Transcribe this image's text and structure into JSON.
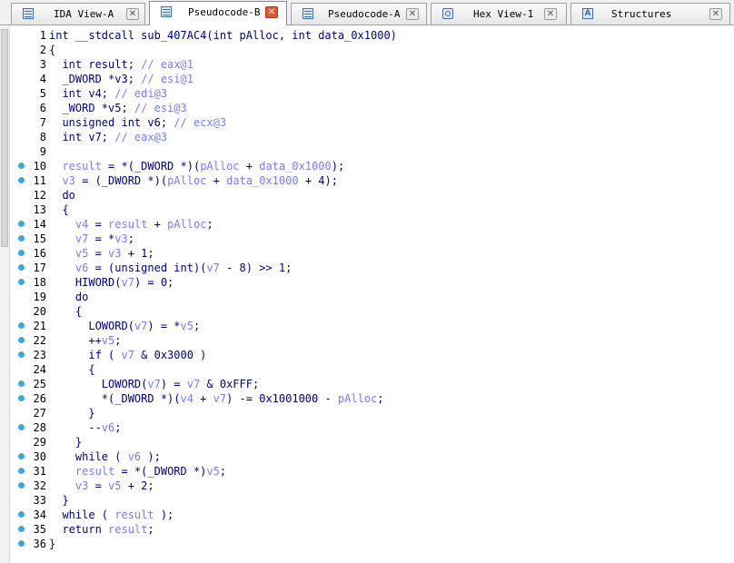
{
  "colors": {
    "keyword": "#000080",
    "variable": "#7a7aff",
    "comment": "#7a7aff",
    "breakpoint": "#3ea6e8",
    "active_tab_close": "#e8542c"
  },
  "tabs": [
    {
      "label": "IDA View-A",
      "icon": "document-icon",
      "active": false
    },
    {
      "label": "Pseudocode-B",
      "icon": "document-icon",
      "active": true
    },
    {
      "label": "Pseudocode-A",
      "icon": "document-icon",
      "active": false
    },
    {
      "label": "Hex View-1",
      "icon": "hex-icon",
      "active": false
    },
    {
      "label": "Structures",
      "icon": "structures-icon",
      "active": false,
      "icon_text": "A"
    }
  ],
  "close_glyph": "✕",
  "code_lines": [
    {
      "n": "1",
      "bp": false,
      "tokens": [
        [
          "int __stdcall sub_407AC4(int pAlloc, int data_0x1000)",
          "k"
        ]
      ]
    },
    {
      "n": "2",
      "bp": false,
      "tokens": [
        [
          "{",
          "p"
        ]
      ]
    },
    {
      "n": "3",
      "bp": false,
      "tokens": [
        [
          "  int result; ",
          "k"
        ],
        [
          "// eax@1",
          "c"
        ]
      ]
    },
    {
      "n": "4",
      "bp": false,
      "tokens": [
        [
          "  _DWORD *v3; ",
          "k"
        ],
        [
          "// esi@1",
          "c"
        ]
      ]
    },
    {
      "n": "5",
      "bp": false,
      "tokens": [
        [
          "  int v4; ",
          "k"
        ],
        [
          "// edi@3",
          "c"
        ]
      ]
    },
    {
      "n": "6",
      "bp": false,
      "tokens": [
        [
          "  _WORD *v5; ",
          "k"
        ],
        [
          "// esi@3",
          "c"
        ]
      ]
    },
    {
      "n": "7",
      "bp": false,
      "tokens": [
        [
          "  unsigned int v6; ",
          "k"
        ],
        [
          "// ecx@3",
          "c"
        ]
      ]
    },
    {
      "n": "8",
      "bp": false,
      "tokens": [
        [
          "  int v7; ",
          "k"
        ],
        [
          "// eax@3",
          "c"
        ]
      ]
    },
    {
      "n": "9",
      "bp": false,
      "tokens": [
        [
          "",
          "p"
        ]
      ]
    },
    {
      "n": "10",
      "bp": true,
      "tokens": [
        [
          "  ",
          "p"
        ],
        [
          "result",
          "v"
        ],
        [
          " = *(_DWORD *)(",
          "p"
        ],
        [
          "pAlloc",
          "v"
        ],
        [
          " + ",
          "p"
        ],
        [
          "data_0x1000",
          "v"
        ],
        [
          ");",
          "p"
        ]
      ]
    },
    {
      "n": "11",
      "bp": true,
      "tokens": [
        [
          "  ",
          "p"
        ],
        [
          "v3",
          "v"
        ],
        [
          " = (_DWORD *)(",
          "p"
        ],
        [
          "pAlloc",
          "v"
        ],
        [
          " + ",
          "p"
        ],
        [
          "data_0x1000",
          "v"
        ],
        [
          " + 4);",
          "p"
        ]
      ]
    },
    {
      "n": "12",
      "bp": false,
      "tokens": [
        [
          "  do",
          "k"
        ]
      ]
    },
    {
      "n": "13",
      "bp": false,
      "tokens": [
        [
          "  {",
          "p"
        ]
      ]
    },
    {
      "n": "14",
      "bp": true,
      "tokens": [
        [
          "    ",
          "p"
        ],
        [
          "v4",
          "v"
        ],
        [
          " = ",
          "p"
        ],
        [
          "result",
          "v"
        ],
        [
          " + ",
          "p"
        ],
        [
          "pAlloc",
          "v"
        ],
        [
          ";",
          "p"
        ]
      ]
    },
    {
      "n": "15",
      "bp": true,
      "tokens": [
        [
          "    ",
          "p"
        ],
        [
          "v7",
          "v"
        ],
        [
          " = *",
          "p"
        ],
        [
          "v3",
          "v"
        ],
        [
          ";",
          "p"
        ]
      ]
    },
    {
      "n": "16",
      "bp": true,
      "tokens": [
        [
          "    ",
          "p"
        ],
        [
          "v5",
          "v"
        ],
        [
          " = ",
          "p"
        ],
        [
          "v3",
          "v"
        ],
        [
          " + 1;",
          "p"
        ]
      ]
    },
    {
      "n": "17",
      "bp": true,
      "tokens": [
        [
          "    ",
          "p"
        ],
        [
          "v6",
          "v"
        ],
        [
          " = (unsigned int)(",
          "p"
        ],
        [
          "v7",
          "v"
        ],
        [
          " - 8) >> 1;",
          "p"
        ]
      ]
    },
    {
      "n": "18",
      "bp": true,
      "tokens": [
        [
          "    HIWORD(",
          "p"
        ],
        [
          "v7",
          "v"
        ],
        [
          ") = 0;",
          "p"
        ]
      ]
    },
    {
      "n": "19",
      "bp": false,
      "tokens": [
        [
          "    do",
          "k"
        ]
      ]
    },
    {
      "n": "20",
      "bp": false,
      "tokens": [
        [
          "    {",
          "p"
        ]
      ]
    },
    {
      "n": "21",
      "bp": true,
      "tokens": [
        [
          "      LOWORD(",
          "p"
        ],
        [
          "v7",
          "v"
        ],
        [
          ") = *",
          "p"
        ],
        [
          "v5",
          "v"
        ],
        [
          ";",
          "p"
        ]
      ]
    },
    {
      "n": "22",
      "bp": true,
      "tokens": [
        [
          "      ++",
          "p"
        ],
        [
          "v5",
          "v"
        ],
        [
          ";",
          "p"
        ]
      ]
    },
    {
      "n": "23",
      "bp": true,
      "tokens": [
        [
          "      if ( ",
          "p"
        ],
        [
          "v7",
          "v"
        ],
        [
          " & 0x3000 )",
          "p"
        ]
      ]
    },
    {
      "n": "24",
      "bp": false,
      "tokens": [
        [
          "      {",
          "p"
        ]
      ]
    },
    {
      "n": "25",
      "bp": true,
      "tokens": [
        [
          "        LOWORD(",
          "p"
        ],
        [
          "v7",
          "v"
        ],
        [
          ") = ",
          "p"
        ],
        [
          "v7",
          "v"
        ],
        [
          " & 0xFFF;",
          "p"
        ]
      ]
    },
    {
      "n": "26",
      "bp": true,
      "tokens": [
        [
          "        *(_DWORD *)(",
          "p"
        ],
        [
          "v4",
          "v"
        ],
        [
          " + ",
          "p"
        ],
        [
          "v7",
          "v"
        ],
        [
          ") -= 0x1001000 - ",
          "p"
        ],
        [
          "pAlloc",
          "v"
        ],
        [
          ";",
          "p"
        ]
      ]
    },
    {
      "n": "27",
      "bp": false,
      "tokens": [
        [
          "      }",
          "p"
        ]
      ]
    },
    {
      "n": "28",
      "bp": true,
      "tokens": [
        [
          "      --",
          "p"
        ],
        [
          "v6",
          "v"
        ],
        [
          ";",
          "p"
        ]
      ]
    },
    {
      "n": "29",
      "bp": false,
      "tokens": [
        [
          "    }",
          "p"
        ]
      ]
    },
    {
      "n": "30",
      "bp": true,
      "tokens": [
        [
          "    while ( ",
          "p"
        ],
        [
          "v6",
          "v"
        ],
        [
          " );",
          "p"
        ]
      ]
    },
    {
      "n": "31",
      "bp": true,
      "tokens": [
        [
          "    ",
          "p"
        ],
        [
          "result",
          "v"
        ],
        [
          " = *(_DWORD *)",
          "p"
        ],
        [
          "v5",
          "v"
        ],
        [
          ";",
          "p"
        ]
      ]
    },
    {
      "n": "32",
      "bp": true,
      "tokens": [
        [
          "    ",
          "p"
        ],
        [
          "v3",
          "v"
        ],
        [
          " = ",
          "p"
        ],
        [
          "v5",
          "v"
        ],
        [
          " + 2;",
          "p"
        ]
      ]
    },
    {
      "n": "33",
      "bp": false,
      "tokens": [
        [
          "  }",
          "p"
        ]
      ]
    },
    {
      "n": "34",
      "bp": true,
      "tokens": [
        [
          "  while ( ",
          "p"
        ],
        [
          "result",
          "v"
        ],
        [
          " );",
          "p"
        ]
      ]
    },
    {
      "n": "35",
      "bp": true,
      "tokens": [
        [
          "  return ",
          "p"
        ],
        [
          "result",
          "v"
        ],
        [
          ";",
          "p"
        ]
      ]
    },
    {
      "n": "36",
      "bp": true,
      "tokens": [
        [
          "}",
          "p"
        ]
      ]
    }
  ]
}
